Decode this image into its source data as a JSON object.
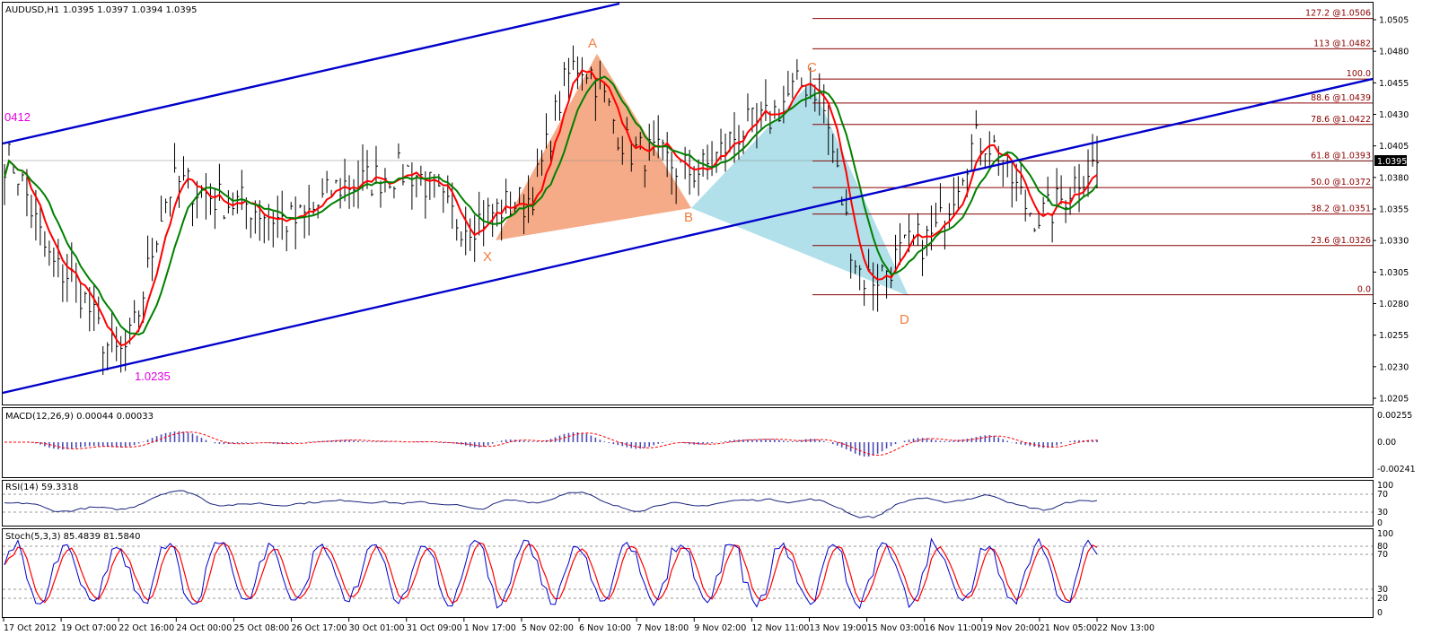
{
  "header": {
    "symbol": "AUDUSD,H1",
    "ohlc": "1.0395 1.0397 1.0394 1.0395"
  },
  "indicators": {
    "macd": "MACD(12,26,9) 0.00044 0.00033",
    "rsi": "RSI(14) 59.3318",
    "stoch": "Stoch(5,3,3) 85.4839 81.5840"
  },
  "price_axis": {
    "ticks": [
      "1.0505",
      "1.0480",
      "1.0455",
      "1.0430",
      "1.0405",
      "1.0380",
      "1.0355",
      "1.0330",
      "1.0305",
      "1.0280",
      "1.0255",
      "1.0230",
      "1.0205"
    ],
    "current": "1.0395"
  },
  "macd_axis": {
    "ticks": [
      "0.00255",
      "0.00",
      "-0.00241"
    ]
  },
  "rsi_axis": {
    "ticks": [
      "100",
      "70",
      "30",
      "0"
    ]
  },
  "stoch_axis": {
    "ticks": [
      "100",
      "80",
      "70",
      "30",
      "20",
      "0"
    ]
  },
  "time_axis": {
    "ticks": [
      "17 Oct 2012",
      "19 Oct 07:00",
      "22 Oct 16:00",
      "24 Oct 00:00",
      "25 Oct 08:00",
      "26 Oct 17:00",
      "30 Oct 01:00",
      "31 Oct 09:00",
      "1 Nov 17:00",
      "5 Nov 02:00",
      "6 Nov 10:00",
      "7 Nov 18:00",
      "9 Nov 02:00",
      "12 Nov 11:00",
      "13 Nov 19:00",
      "15 Nov 03:00",
      "16 Nov 11:00",
      "19 Nov 20:00",
      "21 Nov 05:00",
      "22 Nov 13:00"
    ]
  },
  "annotations": {
    "pattern_points": [
      "X",
      "A",
      "B",
      "C",
      "D"
    ],
    "low_label": "1.0235",
    "left_label": "0412"
  },
  "fibonacci": [
    {
      "label": "127.2 @1.0506",
      "price": 1.0506
    },
    {
      "label": "113 @1.0482",
      "price": 1.0482
    },
    {
      "label": "100.0",
      "price": 1.0458
    },
    {
      "label": "88.6 @1.0439",
      "price": 1.0439
    },
    {
      "label": "78.6 @1.0422",
      "price": 1.0422
    },
    {
      "label": "61.8 @1.0393",
      "price": 1.0393
    },
    {
      "label": "50.0 @1.0372",
      "price": 1.0372
    },
    {
      "label": "38.2 @1.0351",
      "price": 1.0351
    },
    {
      "label": "23.6 @1.0326",
      "price": 1.0326
    },
    {
      "label": "0.0",
      "price": 1.0287
    }
  ],
  "colors": {
    "bars": "#000000",
    "ma_fast": "#ff0000",
    "ma_slow": "#008000",
    "channel": "#0000cc",
    "fib": "#8b0000",
    "pattern_xab": "#f4a27a",
    "pattern_bcd": "#a8dde8",
    "macd_hist": "#4b4bb4",
    "signal": "#ff0000",
    "rsi": "#1a237e",
    "stoch_main": "#0000cc",
    "stoch_signal": "#ff0000",
    "labels": "#f07e3e",
    "magenta": "#e000e0"
  },
  "chart_data": {
    "type": "line",
    "title": "AUDUSD,H1",
    "x": [
      "17 Oct 2012",
      "19 Oct 07:00",
      "22 Oct 16:00",
      "24 Oct 00:00",
      "25 Oct 08:00",
      "26 Oct 17:00",
      "30 Oct 01:00",
      "31 Oct 09:00",
      "1 Nov 17:00",
      "5 Nov 02:00",
      "6 Nov 10:00",
      "7 Nov 18:00",
      "9 Nov 02:00",
      "12 Nov 11:00",
      "13 Nov 19:00",
      "15 Nov 03:00",
      "16 Nov 11:00",
      "19 Nov 20:00",
      "21 Nov 05:00",
      "22 Nov 13:00"
    ],
    "series": [
      {
        "values": [
          1.0395,
          1.0305,
          1.024,
          1.0375,
          1.036,
          1.0345,
          1.0375,
          1.0385,
          1.0345,
          1.036,
          1.047,
          1.04,
          1.0385,
          1.042,
          1.0455,
          1.03,
          1.033,
          1.041,
          1.035,
          1.039
        ]
      }
    ],
    "ylim": [
      1.02,
      1.052
    ],
    "pattern": {
      "X": 1.033,
      "A": 1.0478,
      "B": 1.0358,
      "C": 1.0458,
      "D": 1.0287
    }
  }
}
